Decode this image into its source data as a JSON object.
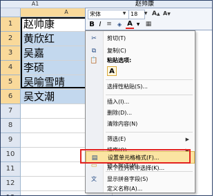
{
  "name_box": "A1",
  "formula_value": "赵帅康",
  "column_header": "A",
  "rows": [
    {
      "num": "1",
      "value": "赵帅康"
    },
    {
      "num": "2",
      "value": "黄欣红"
    },
    {
      "num": "3",
      "value": "吴嘉"
    },
    {
      "num": "4",
      "value": "李硕"
    },
    {
      "num": "5",
      "value": "吴喻雪晴"
    },
    {
      "num": "6",
      "value": "吴文潮"
    },
    {
      "num": "7",
      "value": ""
    },
    {
      "num": "8",
      "value": ""
    },
    {
      "num": "9",
      "value": ""
    },
    {
      "num": "10",
      "value": ""
    },
    {
      "num": "11",
      "value": ""
    },
    {
      "num": "12",
      "value": ""
    },
    {
      "num": "13",
      "value": ""
    }
  ],
  "mini_toolbar": {
    "font": "宋体",
    "size": "18",
    "bold": "B",
    "italic": "I",
    "font_color": "A"
  },
  "menu": {
    "cut": "剪切(T)",
    "copy": "复制(C)",
    "paste_options": "粘贴选项:",
    "paste_glyph": "A",
    "paste_special": "选择性粘贴(S)...",
    "insert": "插入(I)...",
    "delete": "删除(D)...",
    "clear": "清除内容(N)",
    "filter": "筛选(E)",
    "sort": "排序(O)",
    "insert_comment": "插入批注(M)",
    "format_cells": "设置单元格格式(F)...",
    "pick_list": "从下拉列表中选择(K)...",
    "phonetic": "显示拼音字段(S)",
    "define_name": "定义名称(A)..."
  },
  "colors": {
    "selection": "#c3d8ee",
    "highlight": "#fbe4a2",
    "annotation_box": "#e3211f"
  }
}
